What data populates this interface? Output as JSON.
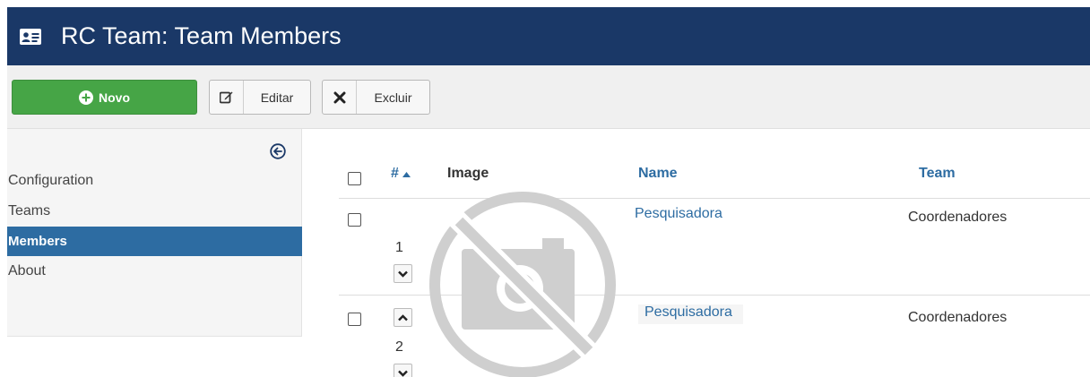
{
  "header": {
    "title": "RC Team: Team Members",
    "icon": "address-card-icon",
    "bg_color": "#1a3867"
  },
  "toolbar": {
    "new_label": "Novo",
    "edit_label": "Editar",
    "delete_label": "Excluir",
    "new_color": "#46a546"
  },
  "sidebar": {
    "items": [
      {
        "label": "Configuration",
        "active": false
      },
      {
        "label": "Teams",
        "active": false
      },
      {
        "label": "Members",
        "active": true
      },
      {
        "label": "About",
        "active": false
      }
    ],
    "active_color": "#2d6ca2"
  },
  "table": {
    "headers": {
      "order": "#",
      "image": "Image",
      "name": "Name",
      "team": "Team"
    },
    "rows": [
      {
        "order": "1",
        "name": "Pesquisadora",
        "team": "Coordenadores"
      },
      {
        "order": "2",
        "name": "Pesquisadora",
        "team": "Coordenadores"
      }
    ],
    "link_color": "#2d6ca2"
  }
}
